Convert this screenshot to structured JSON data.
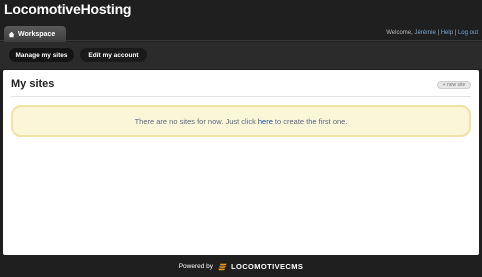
{
  "brand": "LocomotiveHosting",
  "tab": {
    "label": "Workspace",
    "icon": "home-icon"
  },
  "user": {
    "welcome_prefix": "Welcome,",
    "name": "Jérémie",
    "separator1": "|",
    "help": "Help",
    "separator2": "|",
    "logout": "Log out"
  },
  "nav": {
    "manage_sites": "Manage my sites",
    "edit_account": "Edit my account"
  },
  "main": {
    "title": "My sites",
    "new_site_button": "+ new site",
    "notice_before": "There are no sites for now. Just click",
    "notice_link": "here",
    "notice_after": "to create the first one."
  },
  "footer": {
    "powered_by": "Powered by",
    "logo_text": "LOCOMOTIVECMS"
  },
  "colors": {
    "background": "#1f1f1f",
    "notice_bg": "#fbf6d7",
    "notice_border": "#efe3a8",
    "link": "#1d4c9c",
    "logo_accent": "#f29a1c"
  }
}
